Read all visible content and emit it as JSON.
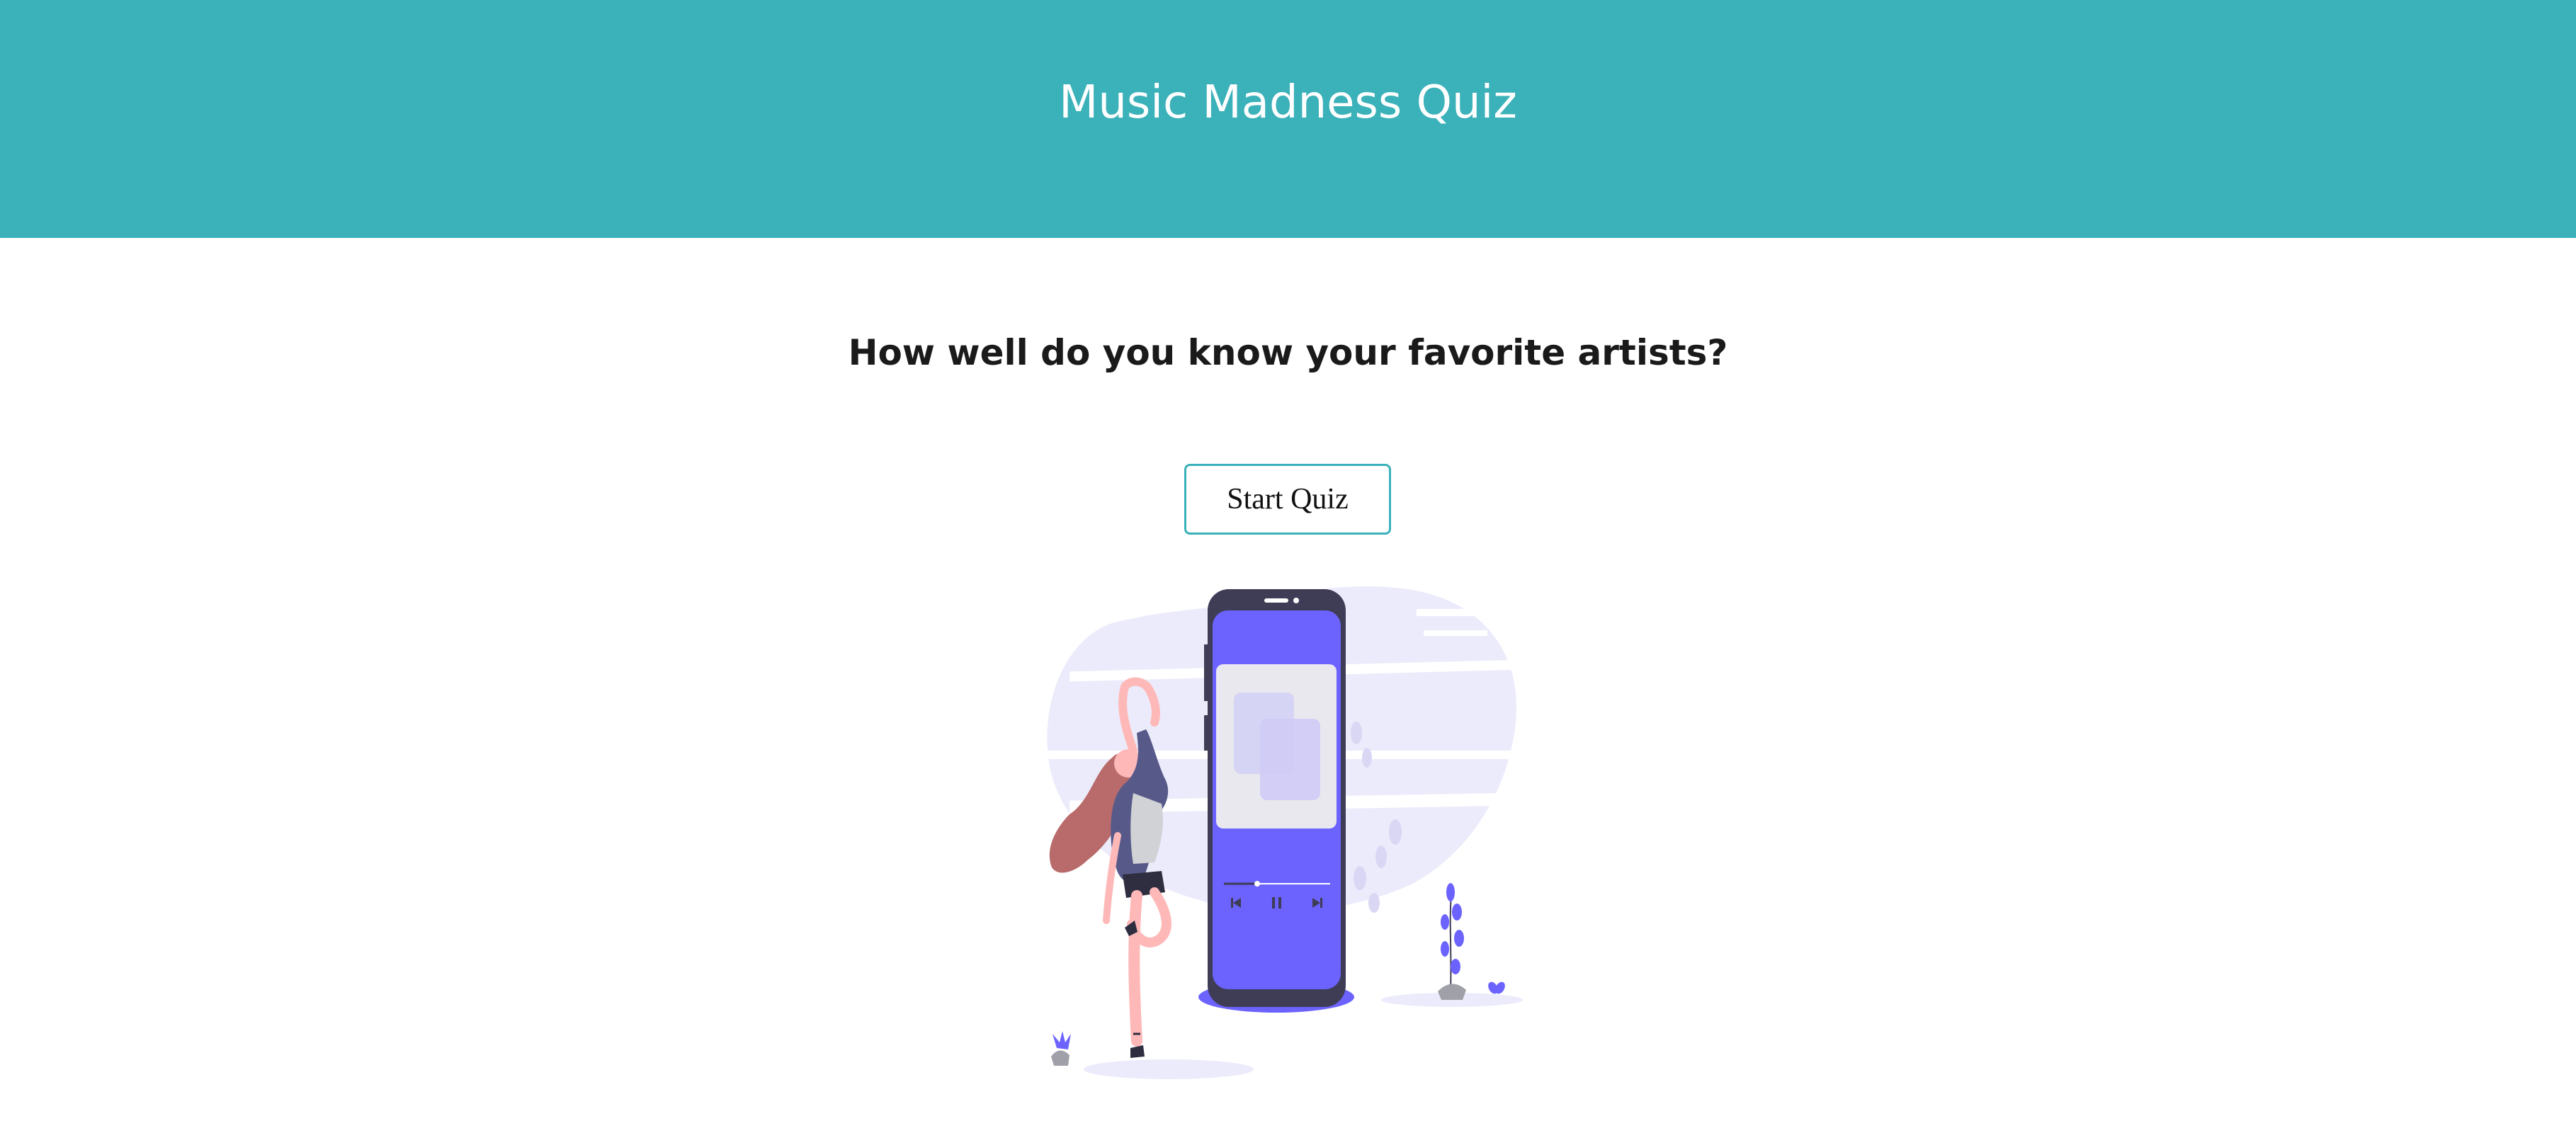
{
  "header": {
    "title": "Music Madness Quiz"
  },
  "main": {
    "subtitle": "How well do you know your favorite artists?",
    "start_button_label": "Start Quiz",
    "illustration_icon": "person-dancing-with-music-player-illustration"
  },
  "colors": {
    "header_bg": "#3bb1b9",
    "accent": "#6c63ff",
    "button_border": "#3bb1b9"
  }
}
